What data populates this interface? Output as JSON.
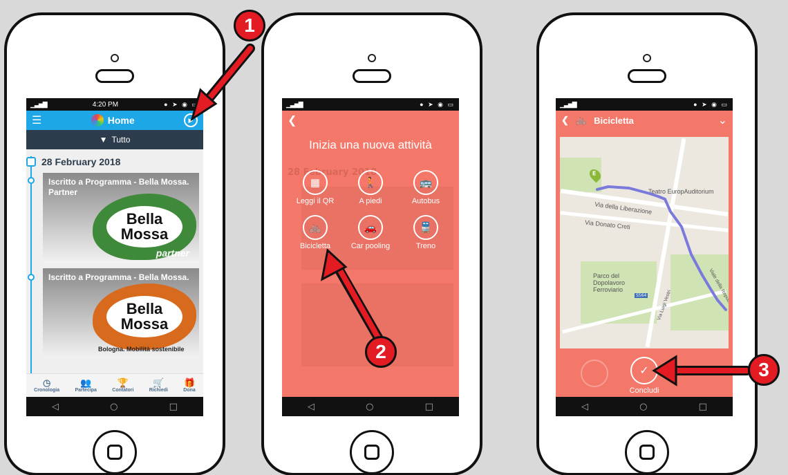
{
  "colors": {
    "background": "#d9d9d9",
    "home_appbar": "#1ea7e6",
    "activity_bg": "#f4786a",
    "callout": "#e31b23"
  },
  "screen1": {
    "time": "4:20 PM",
    "title": "Home",
    "filter_label": "Tutto",
    "date": "28 February 2018",
    "cards": [
      {
        "text": "Iscritto a Programma - Bella Mossa. Partner",
        "logo": "Bella Mossa",
        "badge": "partner"
      },
      {
        "text": "Iscritto a Programma - Bella Mossa.",
        "logo": "Bella Mossa",
        "tagline": "Bologna. Mobilità sostenibile"
      }
    ],
    "tabs": [
      {
        "label": "Cronologia",
        "icon": "clock-icon",
        "glyph": "◷"
      },
      {
        "label": "Partecipa",
        "icon": "people-icon",
        "glyph": "👥"
      },
      {
        "label": "Contatori",
        "icon": "trophy-icon",
        "glyph": "🏆"
      },
      {
        "label": "Richiedi",
        "icon": "cart-icon",
        "glyph": "🛒"
      },
      {
        "label": "Dona",
        "icon": "gift-icon",
        "glyph": "🎁"
      }
    ]
  },
  "screen2": {
    "heading": "Inizia una nuova attività",
    "options": [
      {
        "label": "Leggi il QR",
        "icon": "qr-icon",
        "glyph": "▦"
      },
      {
        "label": "A piedi",
        "icon": "walk-icon",
        "glyph": "🚶"
      },
      {
        "label": "Autobus",
        "icon": "bus-icon",
        "glyph": "🚌"
      },
      {
        "label": "Bicicletta",
        "icon": "bike-icon",
        "glyph": "🚲"
      },
      {
        "label": "Car pooling",
        "icon": "car-icon",
        "glyph": "🚗"
      },
      {
        "label": "Treno",
        "icon": "train-icon",
        "glyph": "🚆"
      }
    ],
    "ghost_date": "28 February 2018"
  },
  "screen3": {
    "title": "Bicicletta",
    "map_labels": [
      "Teatro EuropAuditorium",
      "Via della Liberazione",
      "Via Donato Creti",
      "Parco del Dopolavoro Ferroviario",
      "Via Luigi Vestri",
      "Viale della Repubblica",
      "S564"
    ],
    "pin_label": "E",
    "conclude_label": "Concludi"
  },
  "callouts": [
    "1",
    "2",
    "3"
  ]
}
